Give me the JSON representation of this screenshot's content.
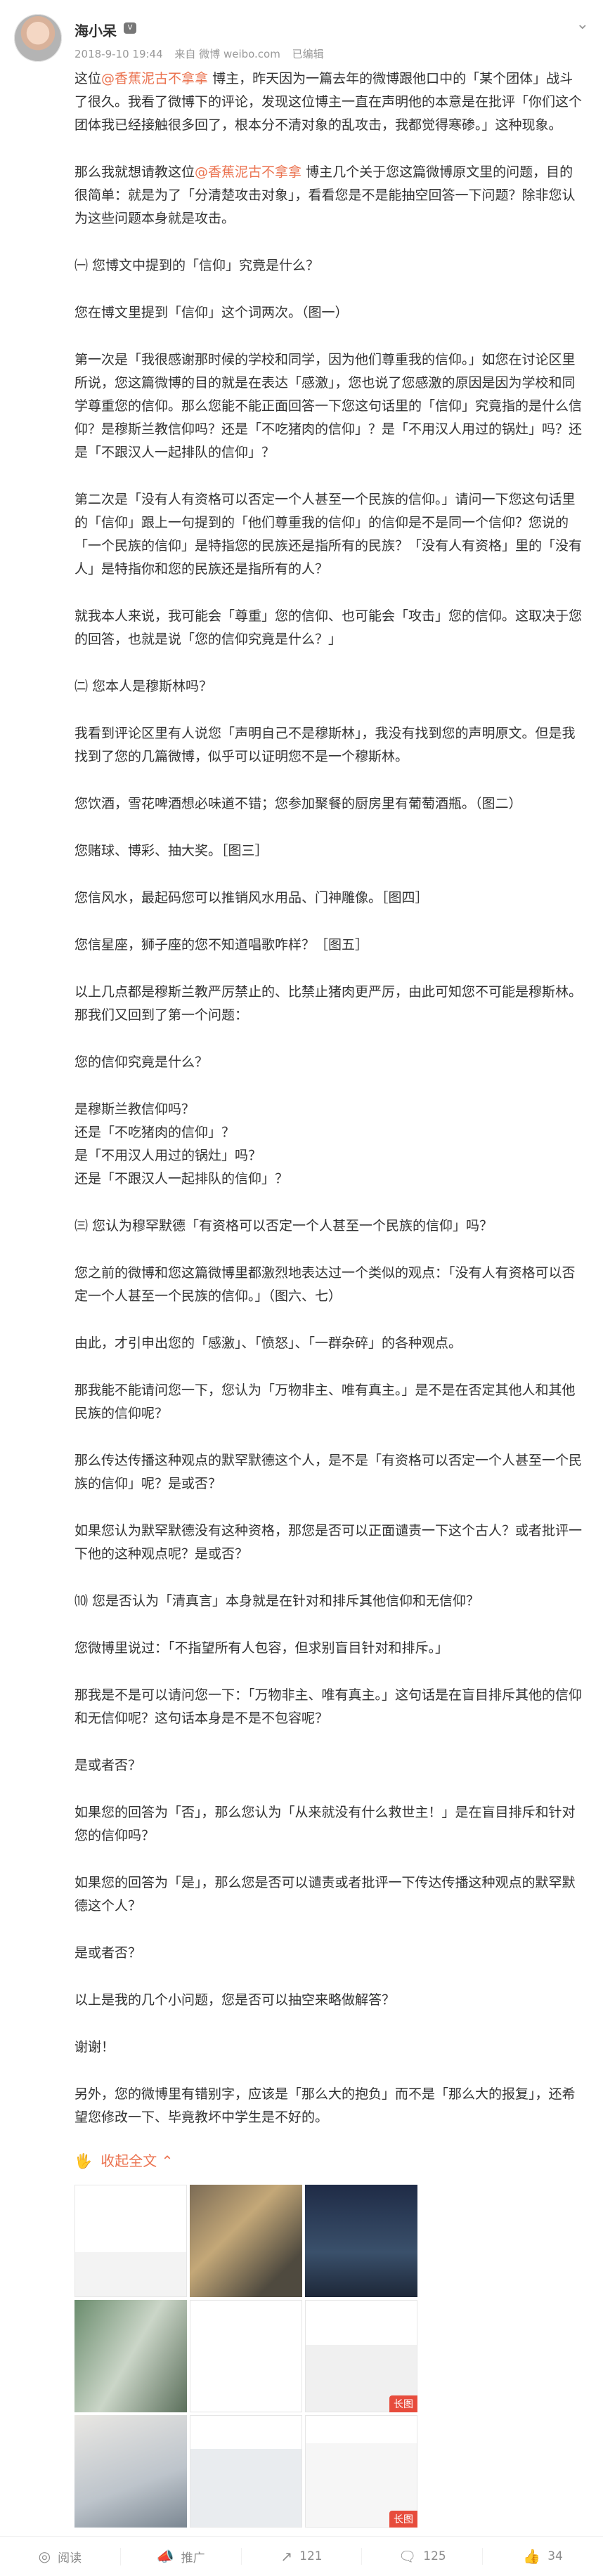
{
  "header": {
    "username": "海小呆",
    "badge_icon": "member-icon",
    "datetime": "2018-9-10 19:44",
    "source": "来自 微博 weibo.com",
    "edited": "已编辑",
    "menu_icon": "chevron-down-icon"
  },
  "paragraphs": [
    {
      "pre": "这位",
      "link": "@香蕉泥古不拿拿",
      "post": " 博主，昨天因为一篇去年的微博跟他口中的「某个团体」战斗了很久。我看了微博下的评论，发现这位博主一直在声明他的本意是在批评「你们这个团体我已经接触很多回了，根本分不清对象的乱攻击，我都觉得寒碜。」这种现象。"
    },
    {
      "pre": "那么我就想请教这位",
      "link": "@香蕉泥古不拿拿",
      "post": " 博主几个关于您这篇微博原文里的问题，目的很简单：就是为了「分清楚攻击对象」，看看您是不是能抽空回答一下问题？除非您认为这些问题本身就是攻击。"
    },
    {
      "text": "㈠ 您博文中提到的「信仰」究竟是什么？"
    },
    {
      "text": "您在博文里提到「信仰」这个词两次。（图一）"
    },
    {
      "text": "第一次是「我很感谢那时候的学校和同学，因为他们尊重我的信仰。」如您在讨论区里所说，您这篇微博的目的就是在表达「感激」，您也说了您感激的原因是因为学校和同学尊重您的信仰。那么您能不能正面回答一下您这句话里的「信仰」究竟指的是什么信仰？是穆斯兰教信仰吗？还是「不吃猪肉的信仰」？是「不用汉人用过的锅灶」吗？还是「不跟汉人一起排队的信仰」？"
    },
    {
      "text": "第二次是「没有人有资格可以否定一个人甚至一个民族的信仰。」请问一下您这句话里的「信仰」跟上一句提到的「他们尊重我的信仰」的信仰是不是同一个信仰？您说的「一个民族的信仰」是特指您的民族还是指所有的民族？「没有人有资格」里的「没有人」是特指你和您的民族还是指所有的人？"
    },
    {
      "text": "就我本人来说，我可能会「尊重」您的信仰、也可能会「攻击」您的信仰。这取决于您的回答，也就是说「您的信仰究竟是什么？」"
    },
    {
      "text": "㈡ 您本人是穆斯林吗？"
    },
    {
      "text": "我看到评论区里有人说您「声明自己不是穆斯林」，我没有找到您的声明原文。但是我找到了您的几篇微博，似乎可以证明您不是一个穆斯林。"
    },
    {
      "text": "您饮酒，雪花啤酒想必味道不错；您参加聚餐的厨房里有葡萄酒瓶。（图二）"
    },
    {
      "text": "您赌球、博彩、抽大奖。［图三］"
    },
    {
      "text": "您信风水，最起码您可以推销风水用品、门神雕像。［图四］"
    },
    {
      "text": "您信星座，狮子座的您不知道唱歌咋样？［图五］"
    },
    {
      "text": "以上几点都是穆斯兰教严厉禁止的、比禁止猪肉更严厉，由此可知您不可能是穆斯林。那我们又回到了第一个问题："
    },
    {
      "text": "您的信仰究竟是什么？"
    },
    {
      "lines": [
        "是穆斯兰教信仰吗？",
        "还是「不吃猪肉的信仰」？",
        "是「不用汉人用过的锅灶」吗？",
        "还是「不跟汉人一起排队的信仰」？"
      ]
    },
    {
      "text": "㈢ 您认为穆罕默德「有资格可以否定一个人甚至一个民族的信仰」吗？"
    },
    {
      "text": "您之前的微博和您这篇微博里都激烈地表达过一个类似的观点：「没有人有资格可以否定一个人甚至一个民族的信仰。」（图六、七）"
    },
    {
      "text": "由此，才引申出您的「感激」、「愤怒」、「一群杂碎」的各种观点。"
    },
    {
      "text": "那我能不能请问您一下，您认为「万物非主、唯有真主。」是不是在否定其他人和其他民族的信仰呢？"
    },
    {
      "text": "那么传达传播这种观点的默罕默德这个人，是不是「有资格可以否定一个人甚至一个民族的信仰」呢？是或否？"
    },
    {
      "text": "如果您认为默罕默德没有这种资格，那您是否可以正面谴责一下这个古人？或者批评一下他的这种观点呢？是或否？"
    },
    {
      "text": "⑽ 您是否认为「清真言」本身就是在针对和排斥其他信仰和无信仰？"
    },
    {
      "text": "您微博里说过：「不指望所有人包容，但求别盲目针对和排斥。」"
    },
    {
      "text": "那我是不是可以请问您一下：「万物非主、唯有真主。」这句话是在盲目排斥其他的信仰和无信仰呢？这句话本身是不是不包容呢？"
    },
    {
      "text": "是或者否？"
    },
    {
      "text": "如果您的回答为「否」，那么您认为「从来就没有什么救世主！」是在盲目排斥和针对您的信仰吗？"
    },
    {
      "text": "如果您的回答为「是」，那么您是否可以谴责或者批评一下传达传播这种观点的默罕默德这个人？"
    },
    {
      "text": "是或者否？"
    },
    {
      "text": "以上是我的几个小问题，您是否可以抽空来略做解答？"
    },
    {
      "text": "谢谢！"
    },
    {
      "text": "另外，您的微博里有错别字，应该是「那么大的抱负」而不是「那么大的报复」，还希望您修改一下、毕竟教坏中学生是不好的。"
    }
  ],
  "expand": {
    "label": "收起全文",
    "icon": "chevron-up-icon",
    "prefix_icon": "hand-icon"
  },
  "images": [
    {
      "id": "img-1",
      "tag": ""
    },
    {
      "id": "img-2",
      "tag": ""
    },
    {
      "id": "img-3",
      "tag": ""
    },
    {
      "id": "img-4",
      "tag": ""
    },
    {
      "id": "img-5",
      "tag": ""
    },
    {
      "id": "img-6",
      "tag": "长图"
    },
    {
      "id": "img-7",
      "tag": ""
    },
    {
      "id": "img-8",
      "tag": ""
    },
    {
      "id": "img-9",
      "tag": "长图"
    }
  ],
  "toolbar": {
    "read": {
      "label": "阅读",
      "icon": "eye-icon"
    },
    "promote": {
      "label": "推广",
      "icon": "megaphone-icon"
    },
    "repost": {
      "count": "121",
      "icon": "repost-icon"
    },
    "comment": {
      "count": "125",
      "icon": "comment-icon"
    },
    "like": {
      "count": "34",
      "icon": "like-icon"
    }
  }
}
